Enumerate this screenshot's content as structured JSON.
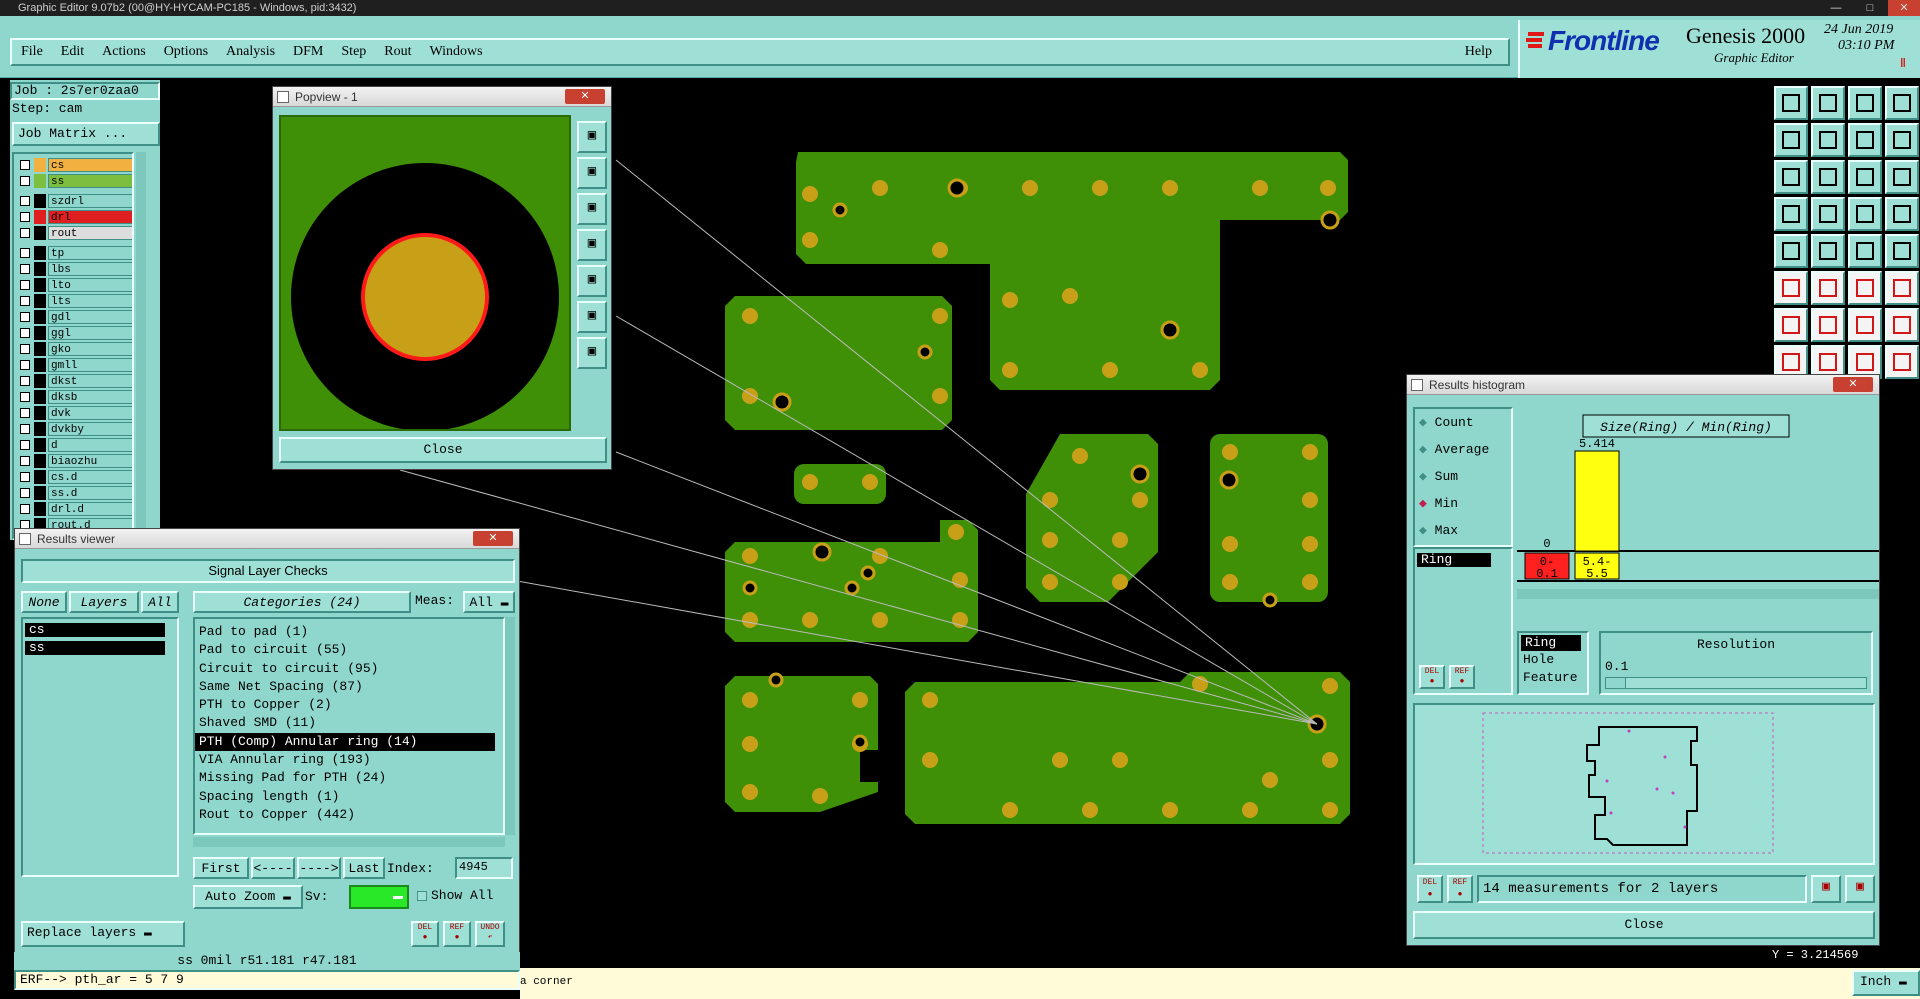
{
  "window": {
    "title": "Graphic Editor 9.07b2 (00@HY-HYCAM-PC185 - Windows, pid:3432)"
  },
  "menu": {
    "items": [
      "File",
      "Edit",
      "Actions",
      "Options",
      "Analysis",
      "DFM",
      "Step",
      "Rout",
      "Windows"
    ],
    "help": "Help"
  },
  "brand": {
    "logo": "Frontline",
    "product": "Genesis 2000",
    "subtitle": "Graphic Editor",
    "date": "24 Jun 2019",
    "time": "03:10 PM"
  },
  "job": {
    "job_label": "Job : 2s7er0zaa0",
    "step_label": "Step: cam",
    "matrix_button": "Job Matrix ..."
  },
  "layers": [
    {
      "name": "cs",
      "color": "#f2b040"
    },
    {
      "name": "ss",
      "color": "#7cbf40"
    },
    {
      "name": "szdrl",
      "color": ""
    },
    {
      "name": "drl",
      "color": "#e02020"
    },
    {
      "name": "rout",
      "color": ""
    },
    {
      "name": "tp",
      "color": ""
    },
    {
      "name": "lbs",
      "color": ""
    },
    {
      "name": "lto",
      "color": ""
    },
    {
      "name": "lts",
      "color": ""
    },
    {
      "name": "gdl",
      "color": ""
    },
    {
      "name": "ggl",
      "color": ""
    },
    {
      "name": "gko",
      "color": ""
    },
    {
      "name": "gmll",
      "color": ""
    },
    {
      "name": "dkst",
      "color": ""
    },
    {
      "name": "dksb",
      "color": ""
    },
    {
      "name": "dvk",
      "color": ""
    },
    {
      "name": "dvkby",
      "color": ""
    },
    {
      "name": "d",
      "color": ""
    },
    {
      "name": "biaozhu",
      "color": ""
    },
    {
      "name": "cs.d",
      "color": ""
    },
    {
      "name": "ss.d",
      "color": ""
    },
    {
      "name": "drl.d",
      "color": ""
    },
    {
      "name": "rout.d",
      "color": ""
    }
  ],
  "popview": {
    "title": "Popview - 1",
    "close": "Close"
  },
  "results_viewer": {
    "title": "Results viewer",
    "header": "Signal Layer Checks",
    "tabs": {
      "none": "None",
      "layers": "Layers",
      "all": "All"
    },
    "categories_label": "Categories (24)",
    "meas_label": "Meas:",
    "meas_value": "All",
    "layer_list": [
      "cs",
      "ss"
    ],
    "categories": [
      "Pad to pad (1)",
      "Pad to circuit (55)",
      "Circuit to circuit (95)",
      "Same Net Spacing (87)",
      "PTH to Copper (2)",
      "Shaved SMD (11)",
      "PTH (Comp) Annular ring (14)",
      "VIA Annular ring (193)",
      "Missing Pad for PTH (24)",
      "Spacing length (1)",
      "Rout to Copper (442)"
    ],
    "selected_category": "PTH (Comp) Annular ring (14)",
    "nav": {
      "first": "First",
      "prev": "<----",
      "next": "---->",
      "last": "Last",
      "index_label": "Index:",
      "index_value": "4945"
    },
    "auto_zoom": "Auto Zoom",
    "sv_label": "Sv:",
    "show_all": "Show All",
    "replace_layers": "Replace layers",
    "icons": {
      "del": "DEL",
      "ref": "REF",
      "undo": "UNDO"
    }
  },
  "info_line": "ss 0mil   r51.181   r47.181",
  "command_line": "ERF--> pth_ar = 5 7 9",
  "status_message": "a corner",
  "histogram": {
    "title": "Results histogram",
    "options": [
      "Count",
      "Average",
      "Sum",
      "Min",
      "Max"
    ],
    "selected_option": "Min",
    "chart_title": "Size(Ring) / Min(Ring)",
    "list": [
      "Ring"
    ],
    "types": [
      "Ring",
      "Hole",
      "Feature"
    ],
    "resolution_label": "Resolution",
    "resolution_value": "0.1",
    "summary": "14 measurements for 2 layers",
    "close": "Close",
    "del": "DEL",
    "ref": "REF"
  },
  "coordinate_readout": "Y = 3.214569",
  "units": "Inch",
  "chart_data": {
    "type": "bar",
    "title": "Size(Ring) / Min(Ring)",
    "categories": [
      "0-0.1",
      "5.4-5.5"
    ],
    "values": [
      0,
      5.414
    ],
    "data_labels": [
      "0",
      "5.414"
    ],
    "colors": [
      "#ff2020",
      "#ffff10"
    ]
  }
}
